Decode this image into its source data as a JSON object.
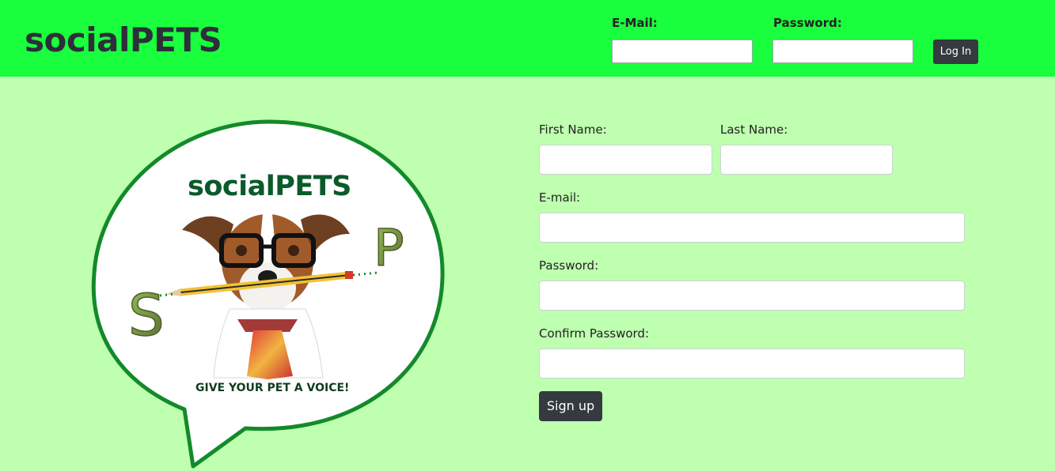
{
  "header": {
    "brand": "socialPETS",
    "email_label": "E-Mail:",
    "password_label": "Password:",
    "login_label": "Log In"
  },
  "logo": {
    "title": "socialPETS",
    "letter_s": "S",
    "letter_p": "P",
    "tagline": "GIVE YOUR PET A VOICE!"
  },
  "signup_form": {
    "first_name_label": "First Name:",
    "last_name_label": "Last Name:",
    "email_label": "E-mail:",
    "password_label": "Password:",
    "confirm_password_label": "Confirm Password:",
    "submit_label": "Sign up"
  },
  "colors": {
    "header_bg": "#19ff3d",
    "page_bg": "#bfffb0",
    "button_bg": "#343a40",
    "logo_green": "#0b5a2b"
  }
}
